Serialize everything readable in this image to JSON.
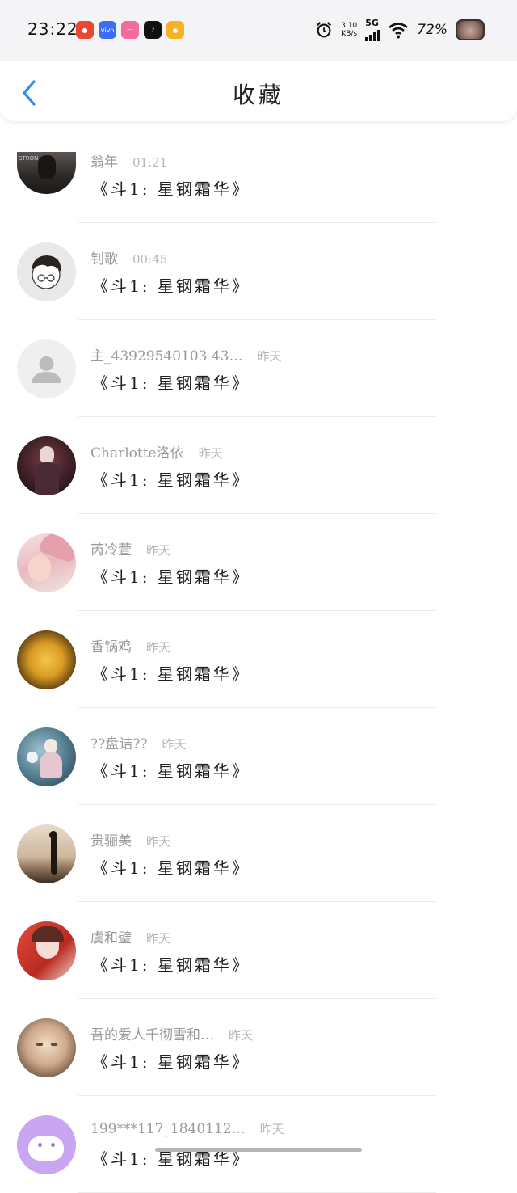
{
  "status_bar": {
    "time": "23:22",
    "net_speed_value": "3.10",
    "net_speed_unit": "KB/s",
    "network": "5G",
    "battery": "72%",
    "app_icons": [
      {
        "name": "app-icon-red",
        "color": "#e9472f",
        "glyph": "●"
      },
      {
        "name": "app-icon-vivo",
        "color": "#3d6cf5",
        "glyph": "vivo"
      },
      {
        "name": "app-icon-pink",
        "color": "#f26b9c",
        "glyph": "▭"
      },
      {
        "name": "app-icon-tiktok",
        "color": "#111111",
        "glyph": "♪"
      },
      {
        "name": "app-icon-weibo",
        "color": "#f4b226",
        "glyph": "◉"
      }
    ]
  },
  "header": {
    "title": "收藏",
    "back_icon": "chevron-left-icon",
    "accent": "#2d8cf0"
  },
  "items": [
    {
      "user": "翁年",
      "time": "01:21",
      "content": "《斗1: 星钢霜华》",
      "avatar": "first"
    },
    {
      "user": "钊歌",
      "time": "00:45",
      "content": "《斗1: 星钢霜华》",
      "avatar": "cartoon"
    },
    {
      "user": "主_43929540103 43…",
      "time": "昨天",
      "content": "《斗1: 星钢霜华》",
      "avatar": "default"
    },
    {
      "user": "Charlotte洛依",
      "time": "昨天",
      "content": "《斗1: 星钢霜华》",
      "avatar": "dark"
    },
    {
      "user": "芮冷萱",
      "time": "昨天",
      "content": "《斗1: 星钢霜华》",
      "avatar": "pink"
    },
    {
      "user": "香锅鸡",
      "time": "昨天",
      "content": "《斗1: 星钢霜华》",
      "avatar": "food"
    },
    {
      "user": "??盘诘??",
      "time": "昨天",
      "content": "《斗1: 星钢霜华》",
      "avatar": "blue"
    },
    {
      "user": "贵骊美",
      "time": "昨天",
      "content": "《斗1: 星钢霜华》",
      "avatar": "sunset"
    },
    {
      "user": "虞和璧",
      "time": "昨天",
      "content": "《斗1: 星钢霜华》",
      "avatar": "red"
    },
    {
      "user": "吾的爱人千彻雪和…",
      "time": "昨天",
      "content": "《斗1: 星钢霜华》",
      "avatar": "face"
    },
    {
      "user": "199***117_1840112…",
      "time": "昨天",
      "content": "《斗1: 星钢霜华》",
      "avatar": "purple"
    }
  ]
}
